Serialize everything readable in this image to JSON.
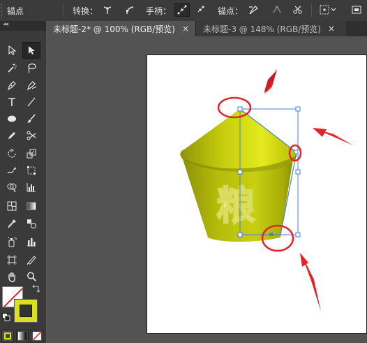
{
  "control_bar": {
    "title": "锚点",
    "convert_label": "转换：",
    "handles_label": "手柄：",
    "anchors_label": "锚点："
  },
  "tabs": [
    {
      "title": "未标题-2* @ 100% (RGB/预览)",
      "close": "×",
      "active": true
    },
    {
      "title": "未标题-3 @ 148% (RGB/预览)",
      "close": "×",
      "active": false
    }
  ],
  "tools_panel": {
    "header_arrows": "◂◂",
    "fill_color": "#ffffff",
    "stroke_color": "#d9e021"
  },
  "artwork": {
    "text": "粮",
    "body_color": "#b3ba09",
    "text_color": "#f1f2a8",
    "selection_color": "#4a7fd0",
    "highlight_color": "#e0242a"
  }
}
